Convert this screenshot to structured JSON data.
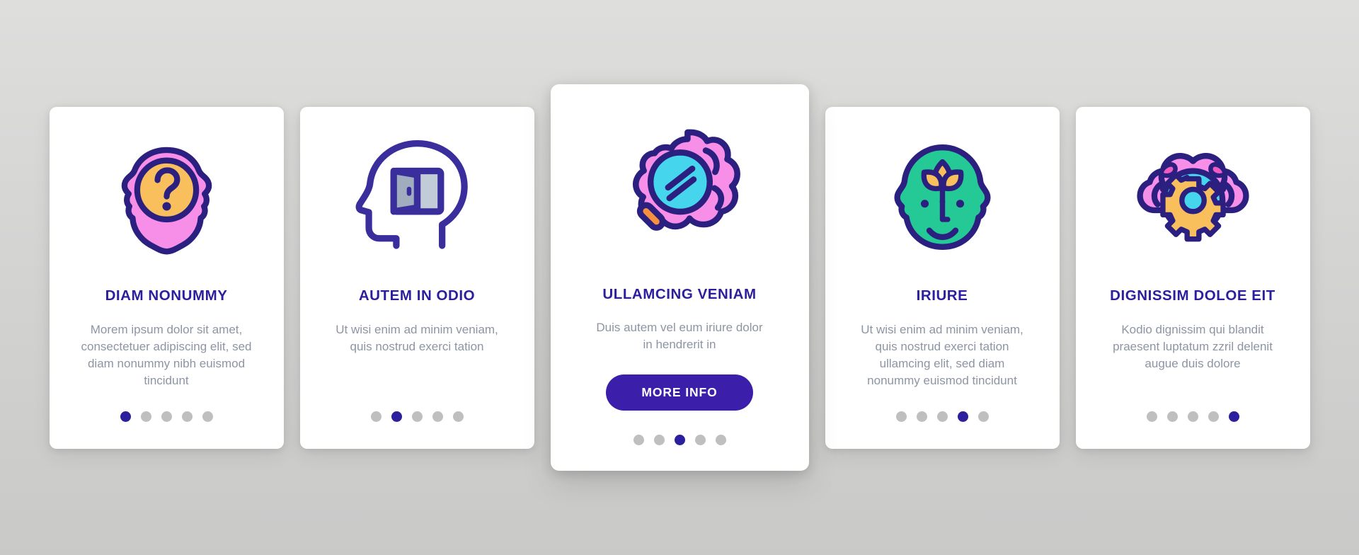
{
  "theme": {
    "background": "#d6d6d5",
    "card_background": "#ffffff",
    "title_color": "#2b1f9e",
    "body_color": "#8d95a3",
    "accent": "#3b1fab",
    "dot_inactive": "#bfbfbf",
    "dot_active": "#2b1f9e",
    "icon_outline": "#2b2080",
    "icon_pink": "#f78fe8",
    "icon_magenta": "#ef5bc0",
    "icon_yellow": "#f9bf5c",
    "icon_cyan": "#45d6ee",
    "icon_green": "#24c995",
    "icon_orange": "#f5903f",
    "icon_gray": "#c2cbd8"
  },
  "cards": [
    {
      "id": "card-diam-nonummy",
      "icon": "head-question-mark-icon",
      "title": "DIAM NONUMMY",
      "body": "Morem ipsum dolor sit amet, consectetuer adipiscing elit, sed diam nonummy nibh euismod tincidunt",
      "featured": false,
      "has_button": false,
      "button_label": "",
      "dots_total": 5,
      "dot_active_index": 0
    },
    {
      "id": "card-autem-in-odio",
      "icon": "head-open-window-icon",
      "title": "AUTEM IN ODIO",
      "body": "Ut wisi enim ad minim veniam, quis nostrud exerci tation",
      "featured": false,
      "has_button": false,
      "button_label": "",
      "dots_total": 5,
      "dot_active_index": 1
    },
    {
      "id": "card-ullamcing-veniam",
      "icon": "brain-magnifier-icon",
      "title": "ULLAMCING VENIAM",
      "body": "Duis autem vel eum iriure dolor in hendrerit in",
      "featured": true,
      "has_button": true,
      "button_label": "MORE INFO",
      "dots_total": 5,
      "dot_active_index": 2
    },
    {
      "id": "card-iriure",
      "icon": "face-sprout-icon",
      "title": "IRIURE",
      "body": "Ut wisi enim ad minim veniam, quis nostrud exerci tation ullamcing elit, sed diam nonummy euismod tincidunt",
      "featured": false,
      "has_button": false,
      "button_label": "",
      "dots_total": 5,
      "dot_active_index": 3
    },
    {
      "id": "card-dignissim-doloe-eit",
      "icon": "brain-gear-icon",
      "title": "DIGNISSIM DOLOE EIT",
      "body": "Kodio dignissim qui blandit praesent luptatum zzril delenit augue duis dolore",
      "featured": false,
      "has_button": false,
      "button_label": "",
      "dots_total": 5,
      "dot_active_index": 4
    }
  ]
}
